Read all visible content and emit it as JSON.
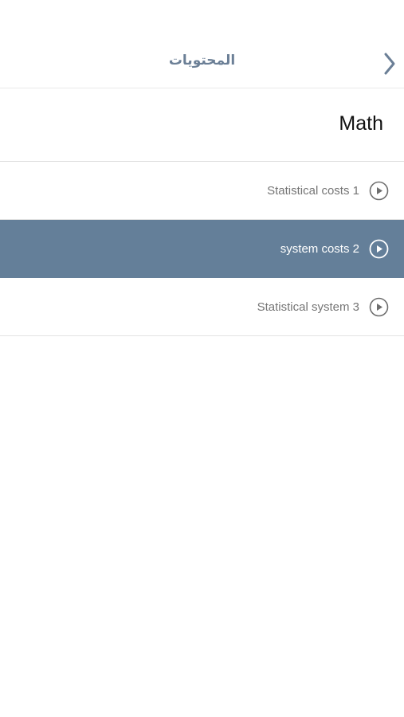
{
  "navbar": {
    "title": "المحتويات",
    "back_icon": "chevron-right-icon"
  },
  "section": {
    "title": "Math"
  },
  "lessons": [
    {
      "label": "Statistical costs 1",
      "icon": "play-circle-icon",
      "selected": false
    },
    {
      "label": "system costs 2",
      "icon": "play-circle-icon",
      "selected": true
    },
    {
      "label": "Statistical system 3",
      "icon": "play-circle-icon",
      "selected": false
    }
  ],
  "colors": {
    "accent": "#647f99",
    "nav_title": "#6b7f96",
    "row_text": "#757575",
    "icon": "#6e6e6e"
  }
}
